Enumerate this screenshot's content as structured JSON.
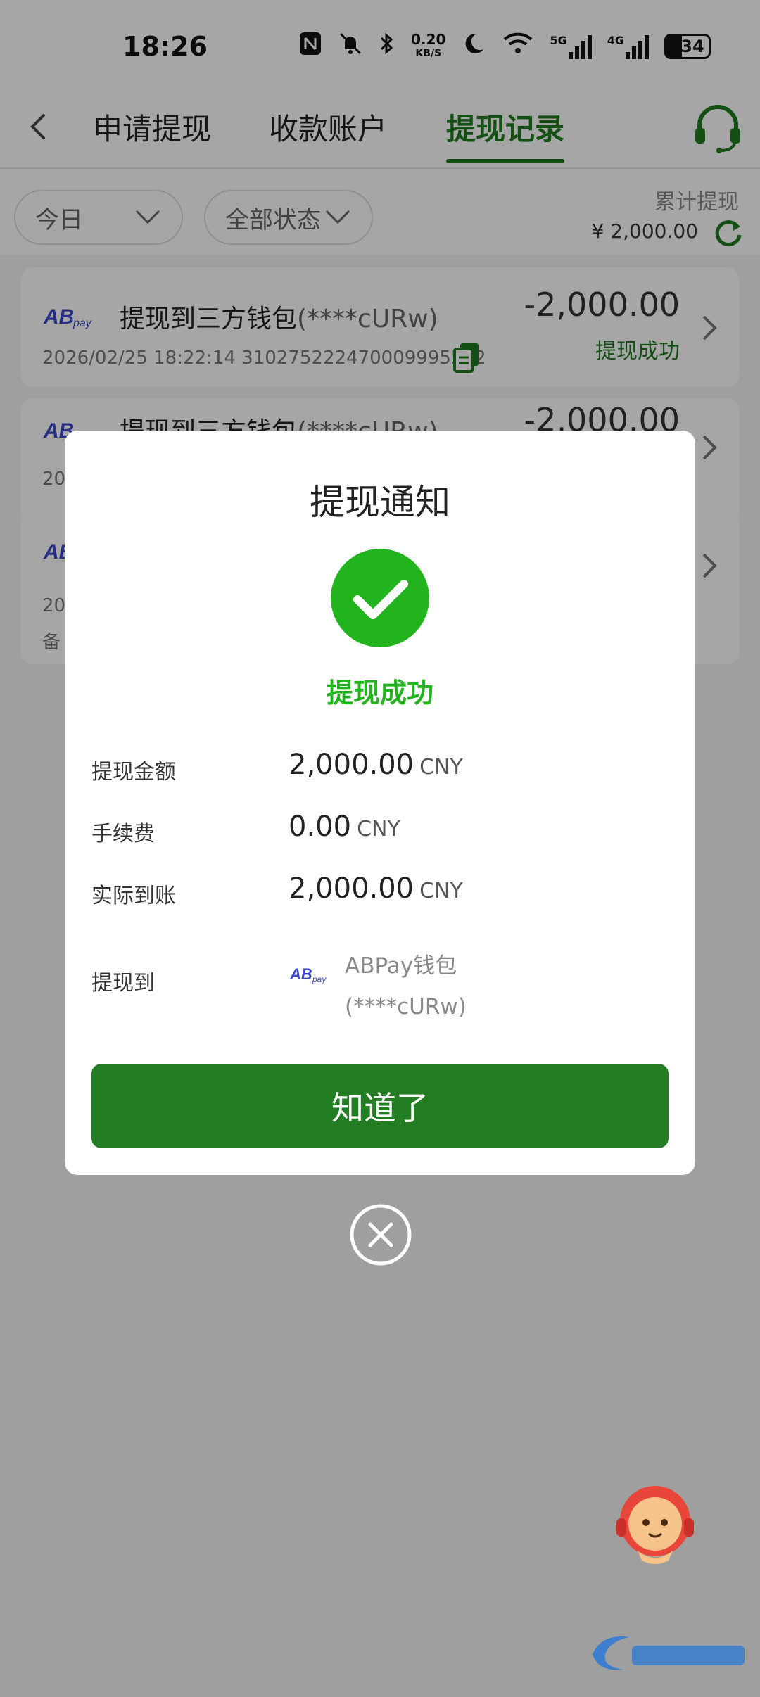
{
  "status_bar": {
    "time": "18:26",
    "speed_value": "0.20",
    "speed_unit": "KB/S",
    "net1": "5G",
    "net2": "4G",
    "battery": "34"
  },
  "header": {
    "tabs": [
      {
        "label": "申请提现"
      },
      {
        "label": "收款账户"
      },
      {
        "label": "提现记录",
        "active": true
      }
    ]
  },
  "filters": {
    "date_select": "今日",
    "status_select": "全部状态",
    "total_label": "累计提现",
    "total_value": "¥ 2,000.00"
  },
  "records": [
    {
      "title": "提现到三方钱包",
      "account": "(****cURw)",
      "amount": "-2,000.00",
      "status": "提现成功",
      "time": "2026/02/25 18:22:14",
      "order_no": "310275222470009995542"
    },
    {
      "title": "提现到三方钱包",
      "account": "(****cURw)",
      "amount": "-2,000.00",
      "meta": "20"
    },
    {
      "meta": "20",
      "note": "备"
    }
  ],
  "dialog": {
    "title": "提现通知",
    "status": "提现成功",
    "rows": [
      {
        "label": "提现金额",
        "value": "2,000.00",
        "unit": "CNY"
      },
      {
        "label": "手续费",
        "value": "0.00",
        "unit": "CNY"
      },
      {
        "label": "实际到账",
        "value": "2,000.00",
        "unit": "CNY"
      }
    ],
    "dest_label": "提现到",
    "dest_wallet": "ABPay钱包",
    "dest_account": "(****cURw)",
    "confirm_label": "知道了"
  },
  "colors": {
    "accent": "#1f7a1f",
    "success": "#22b41c",
    "button": "#237e23"
  }
}
